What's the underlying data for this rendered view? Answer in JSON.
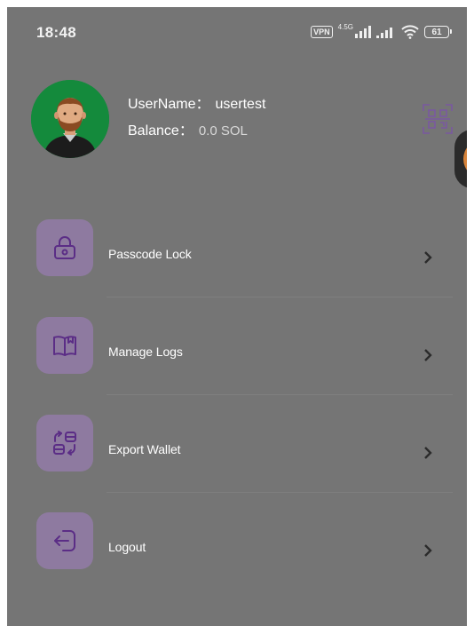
{
  "status_bar": {
    "time": "18:48",
    "vpn": "VPN",
    "network": "4.5G",
    "battery": "61"
  },
  "profile": {
    "username_label": "UserName：",
    "username_value": "usertest",
    "balance_label": "Balance：",
    "balance_value": "0.0 SOL",
    "avatar": "avatar-person-icon",
    "qr_icon": "qr-code-icon"
  },
  "menu": {
    "items": [
      {
        "label": "Passcode Lock",
        "icon": "lock-icon"
      },
      {
        "label": "Manage Logs",
        "icon": "book-icon"
      },
      {
        "label": "Export Wallet",
        "icon": "export-icon"
      },
      {
        "label": "Logout",
        "icon": "logout-icon"
      }
    ]
  },
  "colors": {
    "overlay_background": "#757575",
    "icon_box": "#8e7aa0",
    "icon_stroke": "#5b2d86"
  }
}
